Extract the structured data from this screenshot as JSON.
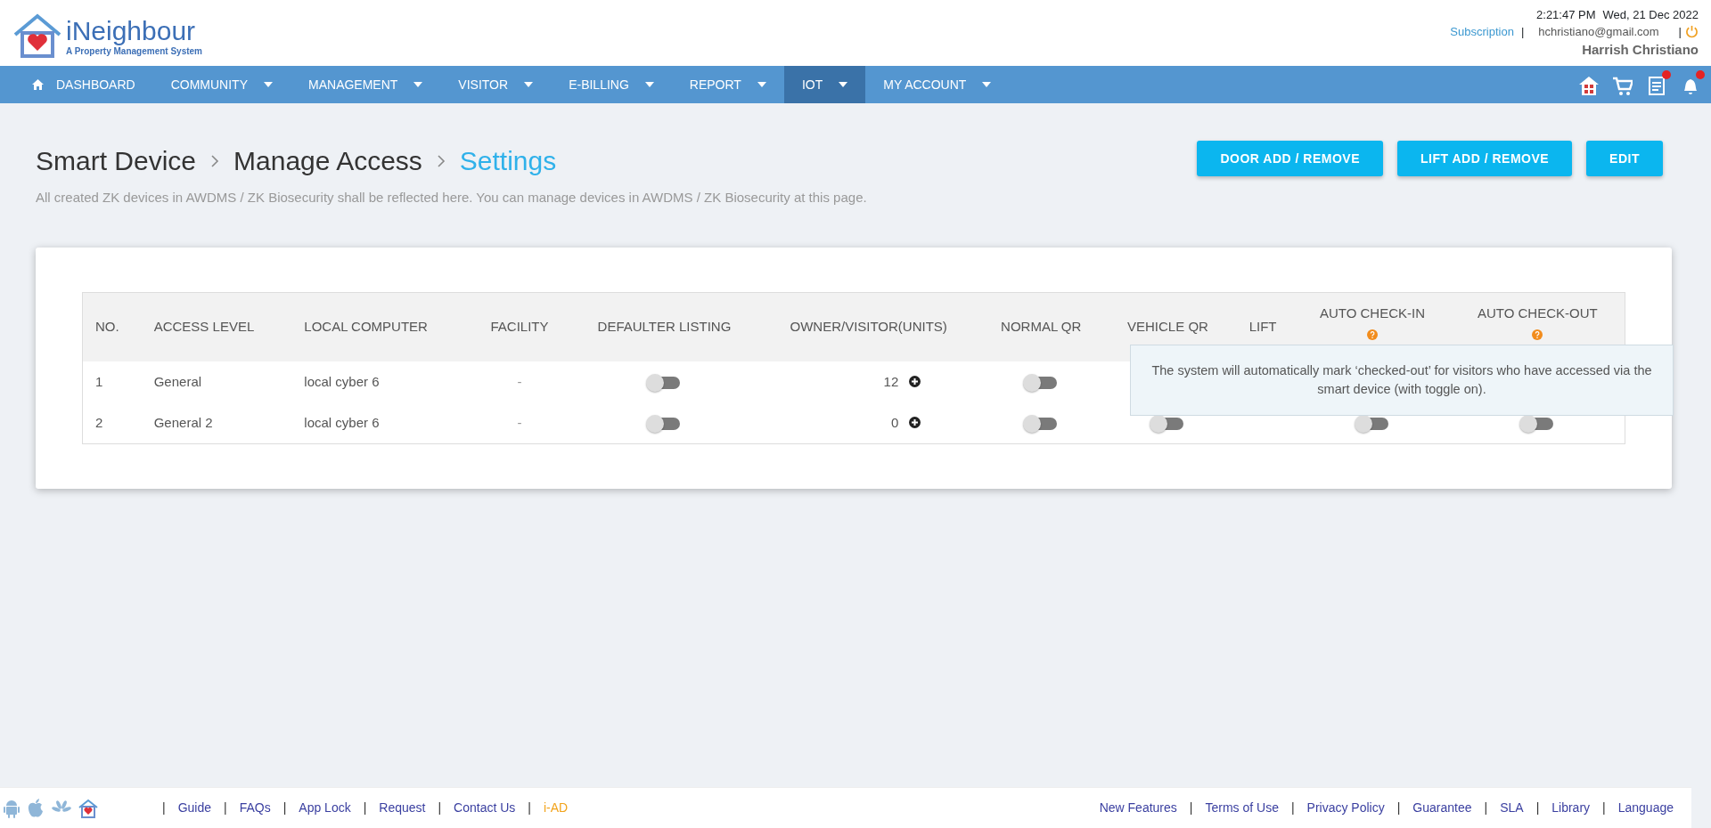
{
  "brand": {
    "name": "iNeighbour",
    "tagline": "A Property Management System"
  },
  "header": {
    "time": "2:21:47 PM",
    "date": "Wed, 21 Dec 2022",
    "subscription": "Subscription",
    "separator_1": "|",
    "email": "hchristiano@gmail.com",
    "separator_2": "|",
    "user": "Harrish Christiano"
  },
  "nav": [
    {
      "label": "DASHBOARD",
      "kind": "home",
      "dropdown": false,
      "selected": false
    },
    {
      "label": "COMMUNITY",
      "kind": "menu",
      "dropdown": true,
      "selected": false
    },
    {
      "label": "MANAGEMENT",
      "kind": "menu",
      "dropdown": true,
      "selected": false
    },
    {
      "label": "VISITOR",
      "kind": "menu",
      "dropdown": true,
      "selected": false
    },
    {
      "label": "E-BILLING",
      "kind": "menu",
      "dropdown": true,
      "selected": false
    },
    {
      "label": "REPORT",
      "kind": "menu",
      "dropdown": true,
      "selected": false
    },
    {
      "label": "IOT",
      "kind": "menu",
      "dropdown": true,
      "selected": true
    },
    {
      "label": "MY ACCOUNT",
      "kind": "menu",
      "dropdown": true,
      "selected": false
    }
  ],
  "nav_icons": [
    {
      "kind": "house",
      "badge": false
    },
    {
      "kind": "cart",
      "badge": false
    },
    {
      "kind": "document",
      "badge": true
    },
    {
      "kind": "bell",
      "badge": true
    }
  ],
  "breadcrumb": [
    {
      "label": "Smart Device",
      "selected": false
    },
    {
      "label": "Manage Access",
      "selected": false
    },
    {
      "label": "Settings",
      "selected": true
    }
  ],
  "description": "All created ZK devices in AWDMS / ZK Biosecurity shall be reflected here. You can manage devices in AWDMS / ZK Biosecurity at this page.",
  "buttons": [
    "DOOR ADD / REMOVE",
    "LIFT ADD / REMOVE",
    "EDIT"
  ],
  "table": {
    "columns": [
      {
        "label": "NO.",
        "help": false
      },
      {
        "label": "ACCESS LEVEL",
        "help": false
      },
      {
        "label": "LOCAL COMPUTER",
        "help": false
      },
      {
        "label": "FACILITY",
        "help": false
      },
      {
        "label": "DEFAULTER LISTING",
        "help": false
      },
      {
        "label": "OWNER/VISITOR(UNITS)",
        "help": false
      },
      {
        "label": "NORMAL QR",
        "help": false
      },
      {
        "label": "VEHICLE QR",
        "help": false
      },
      {
        "label": "LIFT",
        "help": false
      },
      {
        "label": "AUTO CHECK-IN",
        "help": true
      },
      {
        "label": "AUTO CHECK-OUT",
        "help": true
      }
    ],
    "rows": [
      {
        "cells": [
          {
            "kind": "text",
            "text": "1"
          },
          {
            "kind": "text",
            "text": "General"
          },
          {
            "kind": "text",
            "text": "local cyber 6"
          },
          {
            "kind": "text",
            "text": "-"
          },
          {
            "kind": "toggle",
            "checked": false
          },
          {
            "kind": "count",
            "text": "12"
          },
          {
            "kind": "toggle",
            "checked": false
          },
          null,
          null,
          null,
          null
        ]
      },
      {
        "cells": [
          {
            "kind": "text",
            "text": "2"
          },
          {
            "kind": "text",
            "text": "General 2"
          },
          {
            "kind": "text",
            "text": "local cyber 6"
          },
          {
            "kind": "text",
            "text": "-"
          },
          {
            "kind": "toggle",
            "checked": false
          },
          {
            "kind": "count",
            "text": "0"
          },
          {
            "kind": "toggle",
            "checked": false
          },
          {
            "kind": "toggle",
            "checked": false
          },
          null,
          {
            "kind": "toggle",
            "checked": false
          },
          {
            "kind": "toggle",
            "checked": false
          }
        ]
      }
    ],
    "tooltip": "The system will automatically mark ‘checked-out’ for visitors who have accessed via the smart device (with toggle on)."
  },
  "footer": {
    "links": [
      {
        "separator": "|",
        "label": "Guide",
        "highlighted": false
      },
      {
        "separator": "|",
        "label": "FAQs",
        "highlighted": false
      },
      {
        "separator": "|",
        "label": "App Lock",
        "highlighted": false
      },
      {
        "separator": "|",
        "label": "Request",
        "highlighted": false
      },
      {
        "separator": "|",
        "label": "Contact Us",
        "highlighted": false
      },
      {
        "separator": "|",
        "label": "i-AD",
        "highlighted": true
      }
    ],
    "right_links": [
      {
        "label": "New Features"
      },
      {
        "separator": "|",
        "label": "Terms of Use"
      },
      {
        "separator": "|",
        "label": "Privacy Policy"
      },
      {
        "separator": "|",
        "label": "Guarantee"
      },
      {
        "separator": "|",
        "label": "SLA"
      },
      {
        "separator": "|",
        "label": "Library"
      },
      {
        "separator": "|",
        "label": "Language"
      }
    ]
  }
}
